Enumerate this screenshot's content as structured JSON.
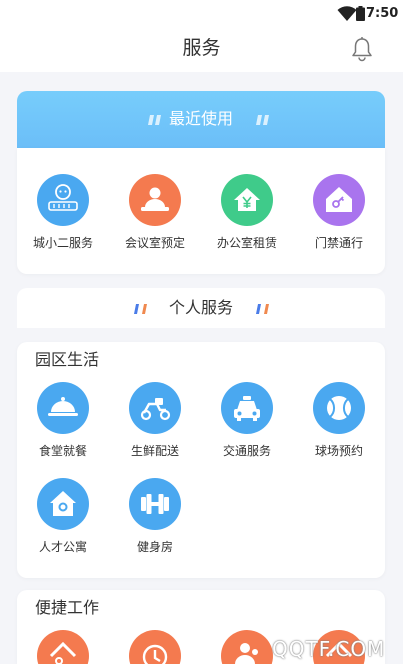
{
  "status_bar": {
    "time": "7:50"
  },
  "header": {
    "title": "服务"
  },
  "recent": {
    "title": "最近使用",
    "items": [
      {
        "label": "城小二服务",
        "icon": "city-mascot-icon",
        "color": "#4aa8f0"
      },
      {
        "label": "会议室预定",
        "icon": "meeting-room-icon",
        "color": "#f47a4f"
      },
      {
        "label": "办公室租赁",
        "icon": "office-rent-icon",
        "color": "#3fcb8a"
      },
      {
        "label": "门禁通行",
        "icon": "access-key-icon",
        "color": "#a974ee"
      }
    ]
  },
  "personal": {
    "title": "个人服务",
    "sections": [
      {
        "title": "园区生活",
        "items": [
          {
            "label": "食堂就餐",
            "icon": "cloche-icon"
          },
          {
            "label": "生鲜配送",
            "icon": "scooter-icon"
          },
          {
            "label": "交通服务",
            "icon": "taxi-icon"
          },
          {
            "label": "球场预约",
            "icon": "ball-icon"
          },
          {
            "label": "人才公寓",
            "icon": "apartment-icon"
          },
          {
            "label": "健身房",
            "icon": "dumbbell-icon"
          }
        ]
      },
      {
        "title": "便捷工作",
        "items": [
          {
            "label": "",
            "icon": "work-shortcut-icon"
          },
          {
            "label": "",
            "icon": "clock-icon"
          },
          {
            "label": "",
            "icon": "person-icon"
          },
          {
            "label": "",
            "icon": "work-shortcut-icon"
          }
        ]
      }
    ]
  },
  "watermark": "QQTF.COM",
  "colors": {
    "blue_icon": "#4aa8f0",
    "orange_icon": "#f47a4f",
    "banner": "#73c6fa",
    "page_bg": "#f4f5f9"
  }
}
